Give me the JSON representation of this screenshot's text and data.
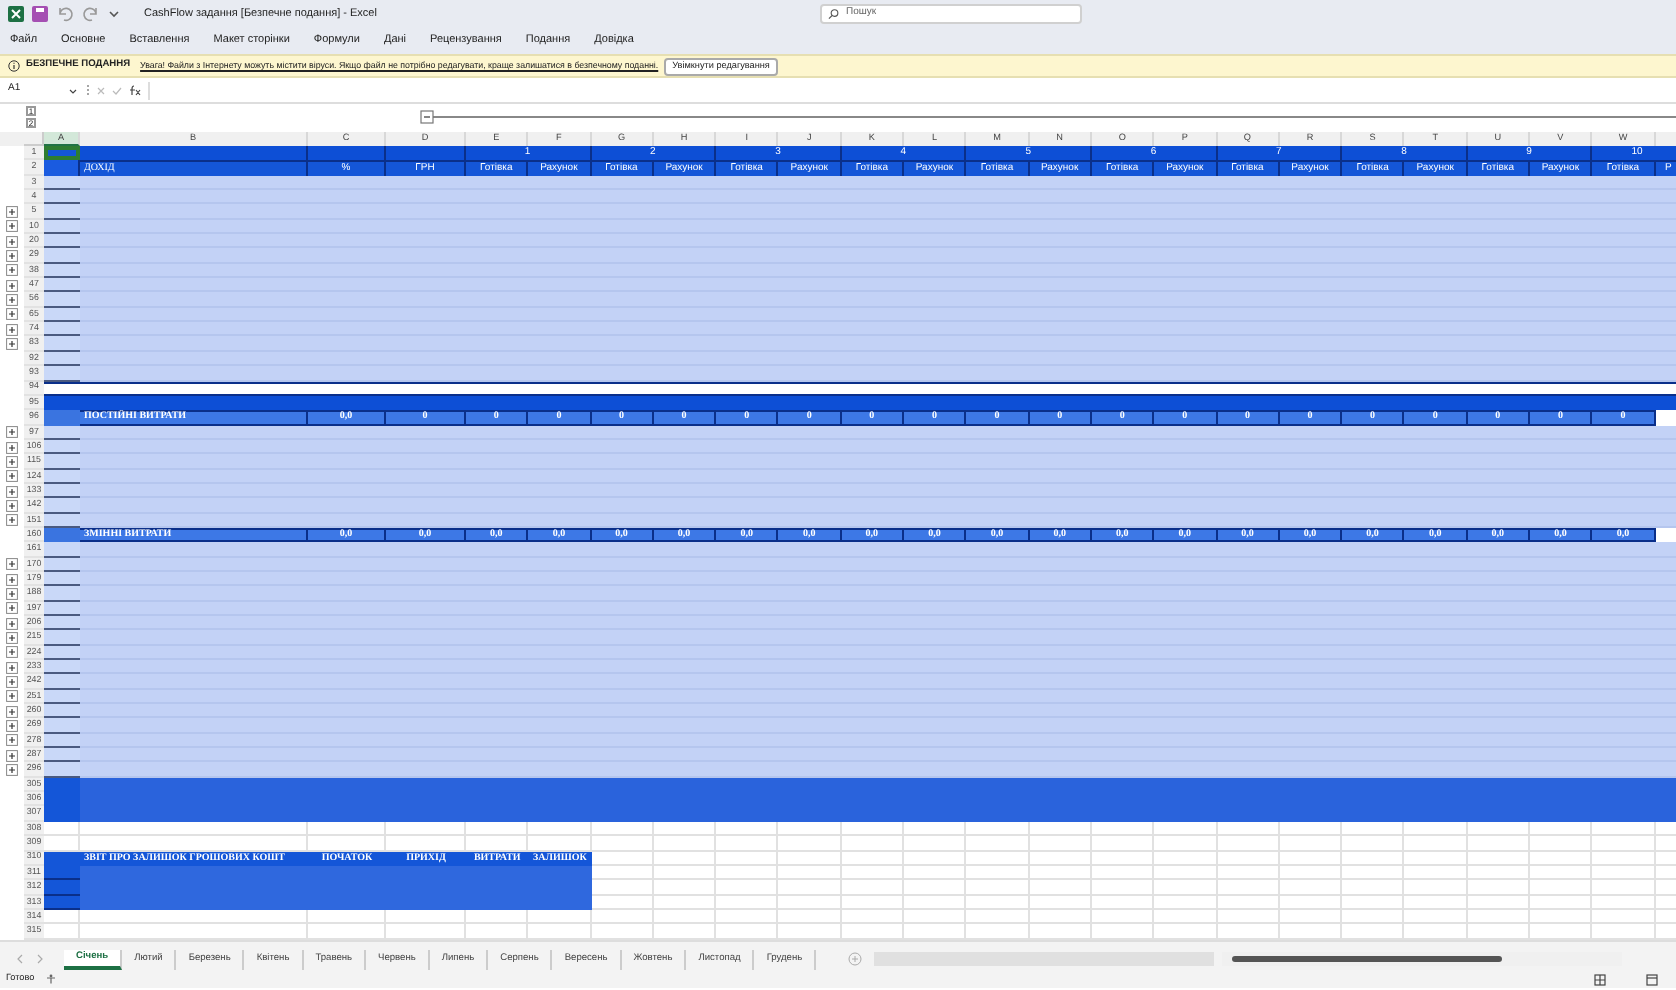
{
  "window": {
    "title": "CashFlow задання [Безпечне подання] - Excel",
    "search_placeholder": "Пошук"
  },
  "menu": [
    "Файл",
    "Основне",
    "Вставлення",
    "Макет сторінки",
    "Формули",
    "Дані",
    "Рецензування",
    "Подання",
    "Довідка"
  ],
  "message_bar": {
    "title": "БЕЗПЕЧНЕ ПОДАННЯ",
    "text": "Увага! Файли з Інтернету можуть містити віруси. Якщо файл не потрібно редагувати, краще залишатися в безпечному поданні.",
    "button": "Увімкнути редагування"
  },
  "formula_bar": {
    "name_box": "A1"
  },
  "outline_levels": [
    "1",
    "2"
  ],
  "columns": [
    "A",
    "B",
    "C",
    "D",
    "E",
    "F",
    "G",
    "H",
    "I",
    "J",
    "K",
    "L",
    "M",
    "N",
    "O",
    "P",
    "Q",
    "R",
    "S",
    "T",
    "U",
    "V",
    "W"
  ],
  "rows": [
    {
      "number": "1",
      "kind": "header",
      "grouped": false,
      "groups": [
        "1",
        "2",
        "3",
        "4",
        "5",
        "6",
        "7",
        "8",
        "9",
        "10"
      ]
    },
    {
      "number": "2",
      "kind": "subheader",
      "grouped": false,
      "cells": [
        "ДОХІД",
        "%",
        "ГРН",
        "Готівка",
        "Рахунок",
        "Готівка",
        "Рахунок",
        "Готівка",
        "Рахунок",
        "Готівка",
        "Рахунок",
        "Готівка",
        "Рахунок",
        "Готівка",
        "Рахунок",
        "Готівка",
        "Рахунок",
        "Готівка",
        "Рахунок",
        "Готівка",
        "Рахунок",
        "Готівка",
        "Р"
      ]
    },
    {
      "number": "3",
      "kind": "data",
      "grouped": false
    },
    {
      "number": "4",
      "kind": "data",
      "grouped": false
    },
    {
      "number": "5",
      "kind": "data",
      "grouped": true
    },
    {
      "number": "10",
      "kind": "data",
      "grouped": true
    },
    {
      "number": "20",
      "kind": "data",
      "grouped": true
    },
    {
      "number": "29",
      "kind": "data",
      "grouped": true
    },
    {
      "number": "38",
      "kind": "data",
      "grouped": true
    },
    {
      "number": "47",
      "kind": "data",
      "grouped": true
    },
    {
      "number": "56",
      "kind": "data",
      "grouped": true
    },
    {
      "number": "65",
      "kind": "data",
      "grouped": true
    },
    {
      "number": "74",
      "kind": "data",
      "grouped": true
    },
    {
      "number": "83",
      "kind": "data",
      "grouped": true
    },
    {
      "number": "92",
      "kind": "data",
      "grouped": false
    },
    {
      "number": "93",
      "kind": "data",
      "grouped": false
    },
    {
      "number": "94",
      "kind": "blank",
      "grouped": false
    },
    {
      "number": "95",
      "kind": "band",
      "grouped": false
    },
    {
      "number": "96",
      "kind": "total",
      "grouped": false,
      "cells": [
        "ПОСТІЙНІ ВИТРАТИ",
        "0,0",
        "0",
        "0",
        "0",
        "0",
        "0",
        "0",
        "0",
        "0",
        "0",
        "0",
        "0",
        "0",
        "0",
        "0",
        "0",
        "0",
        "0",
        "0",
        "0",
        "0"
      ]
    },
    {
      "number": "97",
      "kind": "data",
      "grouped": true
    },
    {
      "number": "106",
      "kind": "data",
      "grouped": true
    },
    {
      "number": "115",
      "kind": "data",
      "grouped": true
    },
    {
      "number": "124",
      "kind": "data",
      "grouped": true
    },
    {
      "number": "133",
      "kind": "data",
      "grouped": true
    },
    {
      "number": "142",
      "kind": "data",
      "grouped": true
    },
    {
      "number": "151",
      "kind": "data",
      "grouped": true
    },
    {
      "number": "160",
      "kind": "total",
      "grouped": false,
      "cells": [
        "ЗМІННІ ВИТРАТИ",
        "0,0",
        "0,0",
        "0,0",
        "0,0",
        "0,0",
        "0,0",
        "0,0",
        "0,0",
        "0,0",
        "0,0",
        "0,0",
        "0,0",
        "0,0",
        "0,0",
        "0,0",
        "0,0",
        "0,0",
        "0,0",
        "0,0",
        "0,0",
        "0,0"
      ]
    },
    {
      "number": "161",
      "kind": "data",
      "grouped": false
    },
    {
      "number": "170",
      "kind": "data",
      "grouped": true
    },
    {
      "number": "179",
      "kind": "data",
      "grouped": true
    },
    {
      "number": "188",
      "kind": "data",
      "grouped": true
    },
    {
      "number": "197",
      "kind": "data",
      "grouped": true
    },
    {
      "number": "206",
      "kind": "data",
      "grouped": true
    },
    {
      "number": "215",
      "kind": "data",
      "grouped": true
    },
    {
      "number": "224",
      "kind": "data",
      "grouped": true
    },
    {
      "number": "233",
      "kind": "data",
      "grouped": true
    },
    {
      "number": "242",
      "kind": "data",
      "grouped": true
    },
    {
      "number": "251",
      "kind": "data",
      "grouped": true
    },
    {
      "number": "260",
      "kind": "data",
      "grouped": true
    },
    {
      "number": "269",
      "kind": "data",
      "grouped": true
    },
    {
      "number": "278",
      "kind": "data",
      "grouped": true
    },
    {
      "number": "287",
      "kind": "data",
      "grouped": true
    },
    {
      "number": "296",
      "kind": "data",
      "grouped": true
    },
    {
      "number": "305",
      "kind": "dark",
      "grouped": false
    },
    {
      "number": "306",
      "kind": "dark",
      "grouped": false
    },
    {
      "number": "307",
      "kind": "dark",
      "grouped": false
    },
    {
      "number": "308",
      "kind": "empty",
      "grouped": false
    },
    {
      "number": "309",
      "kind": "empty",
      "grouped": false
    },
    {
      "number": "310",
      "kind": "report_header",
      "grouped": false,
      "cells": [
        "ЗВІТ ПРО ЗАЛИШОК ГРОШОВИХ КОШТ",
        "ПОЧАТОК",
        "ПРИХІД",
        "ВИТРАТИ",
        "ЗАЛИШОК"
      ]
    },
    {
      "number": "311",
      "kind": "report",
      "grouped": false
    },
    {
      "number": "312",
      "kind": "report",
      "grouped": false
    },
    {
      "number": "313",
      "kind": "report",
      "grouped": false
    },
    {
      "number": "314",
      "kind": "empty",
      "grouped": false
    },
    {
      "number": "315",
      "kind": "empty",
      "grouped": false
    }
  ],
  "sheet_tabs": [
    {
      "label": "Січень",
      "selected": true
    },
    {
      "label": "Лютий",
      "selected": false
    },
    {
      "label": "Березень",
      "selected": false
    },
    {
      "label": "Квітень",
      "selected": false
    },
    {
      "label": "Травень",
      "selected": false
    },
    {
      "label": "Червень",
      "selected": false
    },
    {
      "label": "Липень",
      "selected": false
    },
    {
      "label": "Серпень",
      "selected": false
    },
    {
      "label": "Вересень",
      "selected": false
    },
    {
      "label": "Жовтень",
      "selected": false
    },
    {
      "label": "Листопад",
      "selected": false
    },
    {
      "label": "Грудень",
      "selected": false
    }
  ],
  "status_bar": {
    "text": "Готово"
  }
}
